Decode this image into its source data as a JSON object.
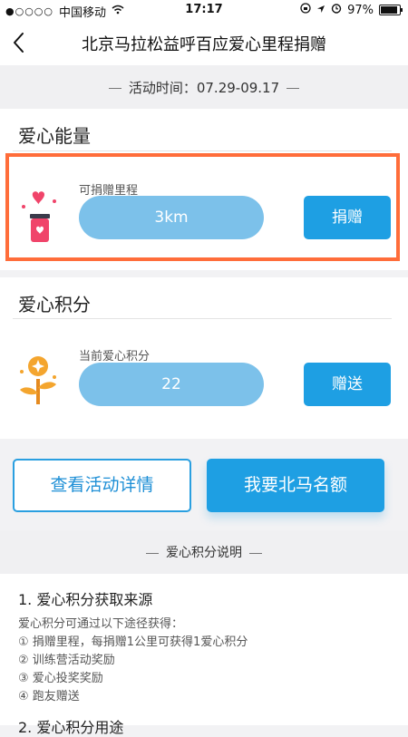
{
  "status_bar": {
    "carrier": "中国移动",
    "time": "17:17",
    "battery": "97%"
  },
  "nav": {
    "title": "北京马拉松益呼百应爱心里程捐赠"
  },
  "activity_time": "活动时间：07.29-09.17",
  "love_energy": {
    "title": "爱心能量",
    "label": "可捐赠里程",
    "value": "3km",
    "button": "捐赠"
  },
  "love_points": {
    "title": "爱心积分",
    "label": "当前爱心积分",
    "value": "22",
    "button": "赠送"
  },
  "actions": {
    "details": "查看活动详情",
    "quota": "我要北马名额"
  },
  "explanation": {
    "title": "爱心积分说明",
    "section1_title": "1. 爱心积分获取来源",
    "intro": "爱心积分可通过以下途径获得：",
    "items": [
      "① 捐赠里程，每捐赠1公里可获得1爱心积分",
      "② 训练营活动奖励",
      "③ 爱心投奖奖励",
      "④ 跑友赠送"
    ],
    "section2_title": "2. 爱心积分用途"
  },
  "colors": {
    "accent": "#1e9fe3",
    "pill": "#7cc1ea",
    "highlight": "#ff6d3a",
    "heart": "#f0446a",
    "gold": "#f4a52e"
  }
}
